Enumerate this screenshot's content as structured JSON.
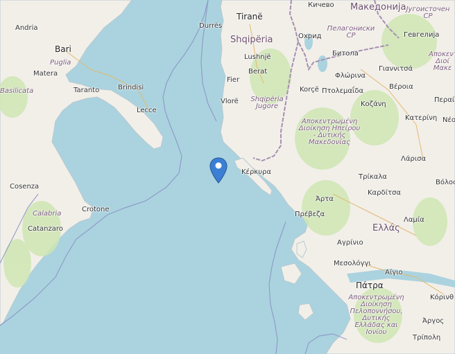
{
  "map": {
    "marker_color": "#3b7fd4",
    "land_color": "#f2efe9",
    "water_color": "#aad3df",
    "forest_color": "#cfe6b3",
    "cities": {
      "andria": "Andria",
      "bari": "Bari",
      "matera": "Matera",
      "taranto": "Taranto",
      "brindisi": "Brindisi",
      "lecce": "Lecce",
      "cosenza": "Cosenza",
      "crotone": "Crotone",
      "catanzaro": "Catanzaro",
      "durres": "Durrës",
      "tirane": "Tiranë",
      "lushnje": "Lushnjë",
      "berat": "Berat",
      "fier": "Fier",
      "vlore": "Vlorë",
      "korce": "Korçë",
      "kichevo": "Кичево",
      "ohrid": "Охрид",
      "bitola": "Битола",
      "gevgelija": "Гевгелија",
      "florina": "Φλώρινα",
      "giannitsa": "Γιαννιτσά",
      "veroia": "Βέροια",
      "ptolemaida": "Πτολεμαΐδα",
      "kozani": "Κοζάνη",
      "katerini": "Κατερίνη",
      "kerkyra": "Κέρκυρα",
      "larisa": "Λάρισα",
      "trikala": "Τρίκαλα",
      "karditsa": "Καρδίτσα",
      "arta": "Άρτα",
      "preveza": "Πρέβεζα",
      "lamia": "Λαμία",
      "volos": "Βόλος",
      "agrinio": "Αγρίνιο",
      "mesolongi": "Μεσολόγγι",
      "patra": "Πάτρα",
      "aigio": "Αίγιο",
      "korinthos": "Κόρινθ",
      "argos": "Άργος",
      "tripoli": "Τρίπολη",
      "perea": "Περαί",
      "neo": "Νέο"
    },
    "regions": {
      "puglia": "Puglia",
      "basilicata": "Basilicata",
      "calabria": "Calabria",
      "shqiperia_jugore": "Shqipëria Jugore",
      "pelagonia": "Пелагониски СР",
      "jugoistochen": "Југоисточен СР",
      "epirus": "Αποκεντρωμένη Διοίκηση Ηπείρου - Δυτικής Μακεδονίας",
      "peloponnese": "Αποκεντρωμένη Διοίκηση Πελοποννήσου, Δυτικής Ελλάδας και Ιονίου",
      "macedonia_gr": "Αποκεντ Διοί Μακε"
    },
    "countries": {
      "albania": "Shqipëria",
      "north_macedonia": "Македонија",
      "greece": "Ελλάς"
    }
  }
}
